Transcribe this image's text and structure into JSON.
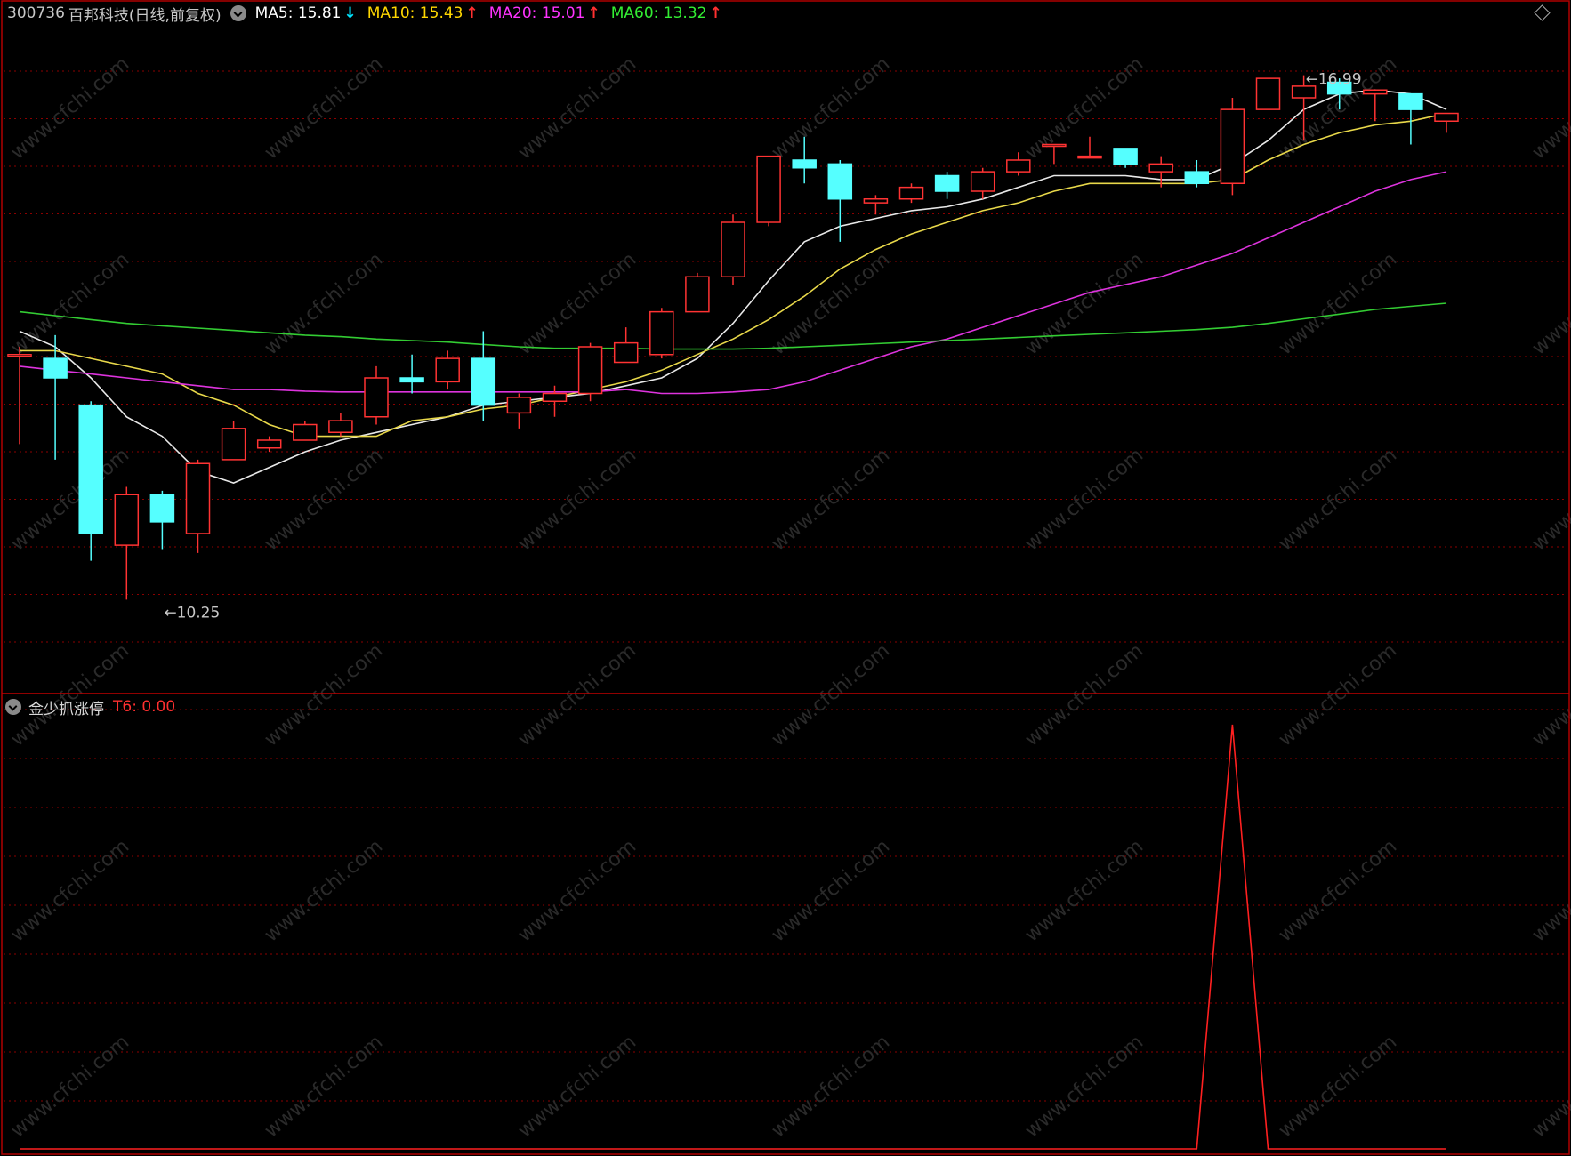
{
  "header": {
    "code": "300736",
    "name": "百邦科技",
    "period": "(日线,前复权)",
    "indicators": [
      {
        "label": "MA5: 15.81",
        "color": "#ffffff",
        "arrow": "↓",
        "arrow_color": "#00e5ff"
      },
      {
        "label": "MA10: 15.43",
        "color": "#ffd700",
        "arrow": "↑",
        "arrow_color": "#ff3030"
      },
      {
        "label": "MA20: 15.01",
        "color": "#ff33ff",
        "arrow": "↑",
        "arrow_color": "#ff3030"
      },
      {
        "label": "MA60: 13.32",
        "color": "#33ee33",
        "arrow": "↑",
        "arrow_color": "#ff3030"
      }
    ]
  },
  "sub_header": {
    "name": "金少抓涨停",
    "value_label": "T6: 0.00",
    "value_color": "#ff3030"
  },
  "colors": {
    "up": "#ff3333",
    "down": "#55ffff",
    "ma5": "#e8e8e8",
    "ma10": "#e8d84a",
    "ma20": "#dd33dd",
    "ma60": "#33cc33",
    "grid": "#8b0000",
    "signal": "#ff2020",
    "label": "#c8c8c8"
  },
  "chart_data": [
    {
      "type": "candlestick",
      "title": "300736 百邦科技(日线,前复权)",
      "ylim": [
        9.5,
        17.5
      ],
      "annotations": [
        {
          "text": "16.99",
          "bar": 36,
          "value": 16.99,
          "kind": "high"
        },
        {
          "text": "10.25",
          "bar": 4,
          "value": 10.25,
          "kind": "low"
        }
      ],
      "candles": [
        {
          "o": 13.4,
          "h": 13.5,
          "l": 12.25,
          "c": 13.4
        },
        {
          "o": 13.35,
          "h": 13.65,
          "l": 12.05,
          "c": 13.1
        },
        {
          "o": 12.75,
          "h": 12.8,
          "l": 10.75,
          "c": 11.1
        },
        {
          "o": 10.95,
          "h": 11.7,
          "l": 10.25,
          "c": 11.6
        },
        {
          "o": 11.6,
          "h": 11.65,
          "l": 10.9,
          "c": 11.25
        },
        {
          "o": 11.1,
          "h": 12.05,
          "l": 10.85,
          "c": 12.0
        },
        {
          "o": 12.05,
          "h": 12.55,
          "l": 12.05,
          "c": 12.45
        },
        {
          "o": 12.2,
          "h": 12.35,
          "l": 12.15,
          "c": 12.3
        },
        {
          "o": 12.3,
          "h": 12.55,
          "l": 12.3,
          "c": 12.5
        },
        {
          "o": 12.4,
          "h": 12.65,
          "l": 12.35,
          "c": 12.55
        },
        {
          "o": 12.6,
          "h": 13.25,
          "l": 12.5,
          "c": 13.1
        },
        {
          "o": 13.1,
          "h": 13.4,
          "l": 12.9,
          "c": 13.05
        },
        {
          "o": 13.05,
          "h": 13.45,
          "l": 12.95,
          "c": 13.35
        },
        {
          "o": 13.35,
          "h": 13.7,
          "l": 12.55,
          "c": 12.75
        },
        {
          "o": 12.65,
          "h": 12.9,
          "l": 12.45,
          "c": 12.85
        },
        {
          "o": 12.8,
          "h": 13.0,
          "l": 12.6,
          "c": 12.9
        },
        {
          "o": 12.9,
          "h": 13.55,
          "l": 12.8,
          "c": 13.5
        },
        {
          "o": 13.3,
          "h": 13.75,
          "l": 13.35,
          "c": 13.55
        },
        {
          "o": 13.4,
          "h": 14.0,
          "l": 13.35,
          "c": 13.95
        },
        {
          "o": 13.95,
          "h": 14.45,
          "l": 13.95,
          "c": 14.4
        },
        {
          "o": 14.4,
          "h": 15.2,
          "l": 14.3,
          "c": 15.1
        },
        {
          "o": 15.1,
          "h": 15.95,
          "l": 15.05,
          "c": 15.95
        },
        {
          "o": 15.9,
          "h": 16.2,
          "l": 15.6,
          "c": 15.8
        },
        {
          "o": 15.85,
          "h": 15.9,
          "l": 14.85,
          "c": 15.4
        },
        {
          "o": 15.35,
          "h": 15.45,
          "l": 15.2,
          "c": 15.4
        },
        {
          "o": 15.4,
          "h": 15.6,
          "l": 15.35,
          "c": 15.55
        },
        {
          "o": 15.7,
          "h": 15.75,
          "l": 15.4,
          "c": 15.5
        },
        {
          "o": 15.5,
          "h": 15.8,
          "l": 15.4,
          "c": 15.75
        },
        {
          "o": 15.75,
          "h": 16.0,
          "l": 15.7,
          "c": 15.9
        },
        {
          "o": 16.1,
          "h": 16.1,
          "l": 15.85,
          "c": 16.1
        },
        {
          "o": 15.95,
          "h": 16.2,
          "l": 15.95,
          "c": 15.95
        },
        {
          "o": 16.05,
          "h": 16.05,
          "l": 15.8,
          "c": 15.85
        },
        {
          "o": 15.75,
          "h": 15.95,
          "l": 15.55,
          "c": 15.85
        },
        {
          "o": 15.75,
          "h": 15.9,
          "l": 15.55,
          "c": 15.6
        },
        {
          "o": 15.6,
          "h": 16.7,
          "l": 15.45,
          "c": 16.55
        },
        {
          "o": 16.55,
          "h": 16.95,
          "l": 16.55,
          "c": 16.95
        },
        {
          "o": 16.7,
          "h": 16.99,
          "l": 16.15,
          "c": 16.85
        },
        {
          "o": 16.9,
          "h": 16.95,
          "l": 16.55,
          "c": 16.75
        },
        {
          "o": 16.75,
          "h": 16.8,
          "l": 16.4,
          "c": 16.8
        },
        {
          "o": 16.75,
          "h": 16.75,
          "l": 16.1,
          "c": 16.55
        },
        {
          "o": 16.4,
          "h": 16.5,
          "l": 16.25,
          "c": 16.5
        }
      ],
      "series": [
        {
          "name": "MA5",
          "values": [
            13.7,
            13.5,
            13.1,
            12.6,
            12.35,
            11.9,
            11.75,
            11.95,
            12.15,
            12.3,
            12.4,
            12.5,
            12.6,
            12.75,
            12.8,
            12.85,
            12.9,
            13.0,
            13.1,
            13.35,
            13.8,
            14.35,
            14.85,
            15.05,
            15.15,
            15.25,
            15.3,
            15.4,
            15.55,
            15.7,
            15.7,
            15.7,
            15.65,
            15.65,
            15.85,
            16.15,
            16.55,
            16.75,
            16.8,
            16.75,
            16.55
          ]
        },
        {
          "name": "MA10",
          "values": [
            13.45,
            13.45,
            13.35,
            13.25,
            13.15,
            12.9,
            12.75,
            12.5,
            12.35,
            12.35,
            12.35,
            12.55,
            12.6,
            12.7,
            12.75,
            12.85,
            12.95,
            13.05,
            13.2,
            13.4,
            13.6,
            13.85,
            14.15,
            14.5,
            14.75,
            14.95,
            15.1,
            15.25,
            15.35,
            15.5,
            15.6,
            15.6,
            15.6,
            15.6,
            15.65,
            15.9,
            16.1,
            16.25,
            16.35,
            16.4,
            16.5
          ]
        },
        {
          "name": "MA20",
          "values": [
            13.25,
            13.2,
            13.15,
            13.1,
            13.05,
            13.0,
            12.95,
            12.95,
            12.93,
            12.92,
            12.92,
            12.92,
            12.92,
            12.92,
            12.92,
            12.92,
            12.92,
            12.95,
            12.9,
            12.9,
            12.92,
            12.95,
            13.05,
            13.2,
            13.35,
            13.5,
            13.6,
            13.75,
            13.9,
            14.05,
            14.2,
            14.3,
            14.4,
            14.55,
            14.7,
            14.9,
            15.1,
            15.3,
            15.5,
            15.65,
            15.75
          ]
        },
        {
          "name": "MA60",
          "values": [
            13.95,
            13.9,
            13.85,
            13.8,
            13.77,
            13.74,
            13.71,
            13.68,
            13.65,
            13.63,
            13.6,
            13.58,
            13.56,
            13.53,
            13.5,
            13.48,
            13.48,
            13.48,
            13.47,
            13.47,
            13.47,
            13.48,
            13.5,
            13.52,
            13.54,
            13.56,
            13.58,
            13.6,
            13.62,
            13.64,
            13.66,
            13.68,
            13.7,
            13.72,
            13.75,
            13.8,
            13.86,
            13.92,
            13.98,
            14.02,
            14.06
          ]
        }
      ]
    },
    {
      "type": "line",
      "title": "金少抓涨停",
      "series": [
        {
          "name": "T6",
          "values": [
            0,
            0,
            0,
            0,
            0,
            0,
            0,
            0,
            0,
            0,
            0,
            0,
            0,
            0,
            0,
            0,
            0,
            0,
            0,
            0,
            0,
            0,
            0,
            0,
            0,
            0,
            0,
            0,
            0,
            0,
            0,
            0,
            0,
            0,
            1,
            0,
            0,
            0,
            0,
            0,
            0
          ]
        }
      ],
      "ylim": [
        0,
        1
      ]
    }
  ]
}
